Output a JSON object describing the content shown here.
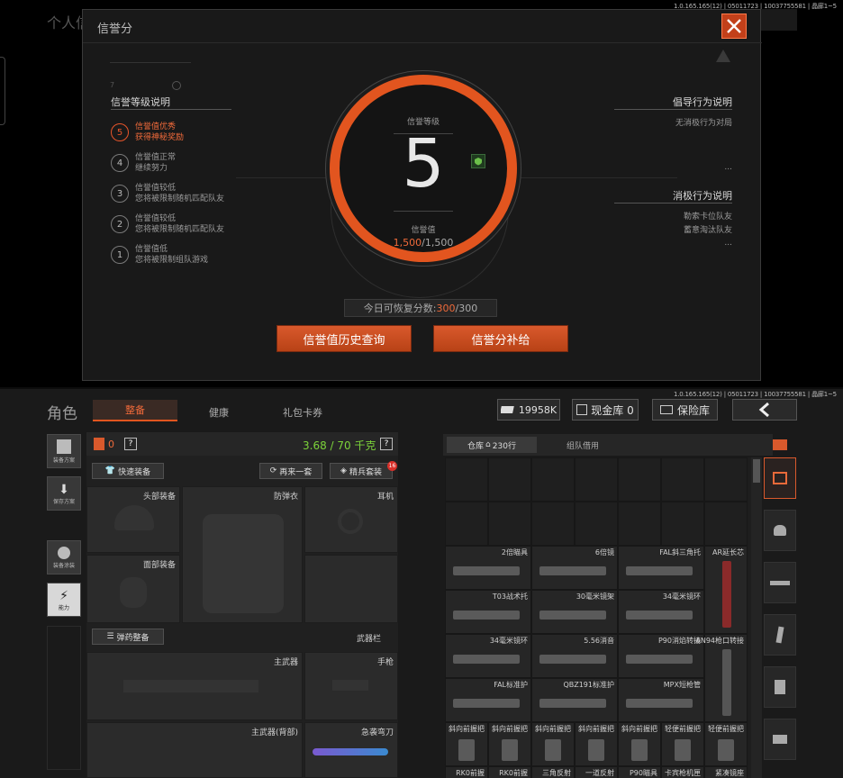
{
  "version_text": "1.0.165.165(12) | 05011723 | 10037755581 | 晶廊1~5",
  "bg_title": "个人信",
  "dialog": {
    "title": "信誉分",
    "left_heading": "信誉等级说明",
    "levels": [
      {
        "num": "5",
        "line1": "信誉值优秀",
        "line2": "获得神秘奖励",
        "active": true
      },
      {
        "num": "4",
        "line1": "信誉值正常",
        "line2": "继续努力"
      },
      {
        "num": "3",
        "line1": "信誉值较低",
        "line2": "您将被限制随机匹配队友"
      },
      {
        "num": "2",
        "line1": "信誉值较低",
        "line2": "您将被限制随机匹配队友"
      },
      {
        "num": "1",
        "line1": "信誉值低",
        "line2": "您将被限制组队游戏"
      }
    ],
    "ring": {
      "level_label": "信誉等级",
      "level": "5",
      "value_label": "信誉值",
      "value_current": "1,500",
      "value_max": "/1,500"
    },
    "right_heading_1": "倡导行为说明",
    "right_item_1": "无消极行为对局",
    "right_heading_2": "消极行为说明",
    "right_items_2": [
      "勒索卡位队友",
      "蓄意淘汰队友"
    ],
    "ellipsis": "...",
    "recover_label": "今日可恢复分数:",
    "recover_current": "300",
    "recover_max": "/300",
    "btn_history": "信誉值历史查询",
    "btn_supply": "信誉分补给"
  },
  "bottom": {
    "page_title": "角色",
    "tabs": [
      "整备",
      "健康",
      "礼包卡券"
    ],
    "currency": "19958K",
    "cash_label": "现金库 0",
    "safe_label": "保险库",
    "side_buttons": [
      "装备方案",
      "保存方案",
      "装备涂装",
      "能力"
    ],
    "weight_count": "0",
    "weight": "3.68 / 70 千克",
    "help": "?",
    "quick_equip": "快速装备",
    "again": "再来一套",
    "elite": "精兵套装",
    "elite_badge": "16",
    "slots": {
      "head": "头部装备",
      "armor": "防弹衣",
      "ear": "耳机",
      "face": "面部装备",
      "ammo_btn": "弹药整备",
      "weapon_bar": "武器栏",
      "main": "主武器",
      "pistol": "手枪",
      "main_back": "主武器(背部)",
      "knife": "急袭弯刀"
    },
    "storage_tab": "仓库",
    "storage_count": "230行",
    "team_tab": "组队借用",
    "items": [
      "2倍瞄具",
      "6倍镜",
      "FAL斜三角托",
      "AR延长芯",
      "T03战术托",
      "30毫米镜架",
      "34毫米镜环",
      "34毫米镜环",
      "5.56消音",
      "P90消焰转接",
      "AN94枪口转接",
      "FAL标准护",
      "QBZ191标准护",
      "MPX短枪管",
      "斜向前握把",
      "斜向前握把",
      "斜向前握把",
      "斜向前握把",
      "斜向前握把",
      "轻便前握把",
      "轻便前握把",
      "RK0前握",
      "RK0前握",
      "三角反射",
      "一道反射",
      "P90瞄具",
      "卡宾枪机匣",
      "紧凑镜座"
    ]
  }
}
